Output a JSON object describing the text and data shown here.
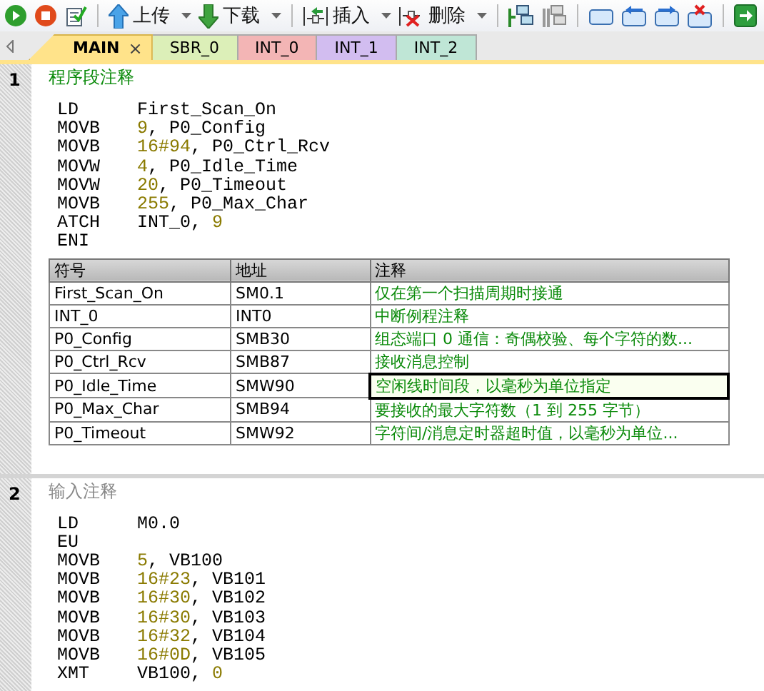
{
  "toolbar": [
    {
      "kind": "run"
    },
    {
      "kind": "stop"
    },
    {
      "kind": "compile"
    },
    {
      "kind": "sep"
    },
    {
      "kind": "upload",
      "label": "上传"
    },
    {
      "kind": "download",
      "label": "下载"
    },
    {
      "kind": "sep"
    },
    {
      "kind": "insert",
      "label": "插入"
    },
    {
      "kind": "delete",
      "label": "删除"
    },
    {
      "kind": "sep"
    },
    {
      "kind": "net"
    },
    {
      "kind": "net2"
    },
    {
      "kind": "sep"
    },
    {
      "kind": "win"
    },
    {
      "kind": "winleft"
    },
    {
      "kind": "winright"
    },
    {
      "kind": "winclose"
    },
    {
      "kind": "sep"
    },
    {
      "kind": "go"
    }
  ],
  "tabs": [
    {
      "label": "MAIN",
      "selected": true,
      "color": "#ffe38a",
      "close": "×"
    },
    {
      "label": "SBR_0",
      "selected": false,
      "color": "#dcefb8"
    },
    {
      "label": "INT_0",
      "selected": false,
      "color": "#f3b5b5"
    },
    {
      "label": "INT_1",
      "selected": false,
      "color": "#d2bdf0"
    },
    {
      "label": "INT_2",
      "selected": false,
      "color": "#bfe6d6"
    }
  ],
  "networks": [
    {
      "number": "1",
      "comment": {
        "text": "程序段注释",
        "kind": "set"
      },
      "code": [
        {
          "op": "LD",
          "args": [
            {
              "text": "First_Scan_On",
              "kind": "symbol"
            }
          ]
        },
        {
          "op": "MOVB",
          "args": [
            {
              "text": "9",
              "kind": "constant"
            },
            {
              "text": ", ",
              "kind": "symbol"
            },
            {
              "text": "P0_Config",
              "kind": "symbol"
            }
          ]
        },
        {
          "op": "MOVB",
          "args": [
            {
              "text": "16#94",
              "kind": "constant"
            },
            {
              "text": ", ",
              "kind": "symbol"
            },
            {
              "text": "P0_Ctrl_Rcv",
              "kind": "symbol"
            }
          ]
        },
        {
          "op": "MOVW",
          "args": [
            {
              "text": "4",
              "kind": "constant"
            },
            {
              "text": ", ",
              "kind": "symbol"
            },
            {
              "text": "P0_Idle_Time",
              "kind": "symbol"
            }
          ]
        },
        {
          "op": "MOVW",
          "args": [
            {
              "text": "20",
              "kind": "constant"
            },
            {
              "text": ", ",
              "kind": "symbol"
            },
            {
              "text": "P0_Timeout",
              "kind": "symbol"
            }
          ]
        },
        {
          "op": "MOVB",
          "args": [
            {
              "text": "255",
              "kind": "constant"
            },
            {
              "text": ", ",
              "kind": "symbol"
            },
            {
              "text": "P0_Max_Char",
              "kind": "symbol"
            }
          ]
        },
        {
          "op": "ATCH",
          "args": [
            {
              "text": "INT_0",
              "kind": "symbol"
            },
            {
              "text": ", ",
              "kind": "symbol"
            },
            {
              "text": "9",
              "kind": "constant"
            }
          ]
        },
        {
          "op": "ENI"
        }
      ],
      "table": {
        "columns": [
          "符号",
          "地址",
          "注释"
        ],
        "rows": [
          {
            "symbol": "First_Scan_On",
            "address": "SM0.1",
            "comment": "仅在第一个扫描周期时接通",
            "selected": false
          },
          {
            "symbol": "INT_0",
            "address": "INT0",
            "comment": "中断例程注释",
            "selected": false
          },
          {
            "symbol": "P0_Config",
            "address": "SMB30",
            "comment": "组态端口 0 通信：奇偶校验、每个字符的数...",
            "selected": false
          },
          {
            "symbol": "P0_Ctrl_Rcv",
            "address": "SMB87",
            "comment": "接收消息控制",
            "selected": false
          },
          {
            "symbol": "P0_Idle_Time",
            "address": "SMW90",
            "comment": "空闲线时间段，以毫秒为单位指定",
            "selected": true
          },
          {
            "symbol": "P0_Max_Char",
            "address": "SMB94",
            "comment": "要接收的最大字符数（1 到 255 字节）",
            "selected": false
          },
          {
            "symbol": "P0_Timeout",
            "address": "SMW92",
            "comment": "字符间/消息定时器超时值，以毫秒为单位...",
            "selected": false
          }
        ]
      }
    },
    {
      "number": "2",
      "comment": {
        "text": "输入注释",
        "kind": "empty"
      },
      "code": [
        {
          "op": "LD",
          "args": [
            {
              "text": "M0.0",
              "kind": "symbol"
            }
          ]
        },
        {
          "op": "EU"
        },
        {
          "op": "MOVB",
          "args": [
            {
              "text": "5",
              "kind": "constant"
            },
            {
              "text": ", ",
              "kind": "symbol"
            },
            {
              "text": "VB100",
              "kind": "symbol"
            }
          ]
        },
        {
          "op": "MOVB",
          "args": [
            {
              "text": "16#23",
              "kind": "constant"
            },
            {
              "text": ", ",
              "kind": "symbol"
            },
            {
              "text": "VB101",
              "kind": "symbol"
            }
          ]
        },
        {
          "op": "MOVB",
          "args": [
            {
              "text": "16#30",
              "kind": "constant"
            },
            {
              "text": ", ",
              "kind": "symbol"
            },
            {
              "text": "VB102",
              "kind": "symbol"
            }
          ]
        },
        {
          "op": "MOVB",
          "args": [
            {
              "text": "16#30",
              "kind": "constant"
            },
            {
              "text": ", ",
              "kind": "symbol"
            },
            {
              "text": "VB103",
              "kind": "symbol"
            }
          ]
        },
        {
          "op": "MOVB",
          "args": [
            {
              "text": "16#32",
              "kind": "constant"
            },
            {
              "text": ", ",
              "kind": "symbol"
            },
            {
              "text": "VB104",
              "kind": "symbol"
            }
          ]
        },
        {
          "op": "MOVB",
          "args": [
            {
              "text": "16#0D",
              "kind": "constant"
            },
            {
              "text": ", ",
              "kind": "symbol"
            },
            {
              "text": "VB105",
              "kind": "symbol"
            }
          ]
        },
        {
          "op": "XMT",
          "args": [
            {
              "text": "VB100",
              "kind": "symbol"
            },
            {
              "text": ", ",
              "kind": "symbol"
            },
            {
              "text": "0",
              "kind": "constant"
            }
          ]
        }
      ]
    }
  ]
}
